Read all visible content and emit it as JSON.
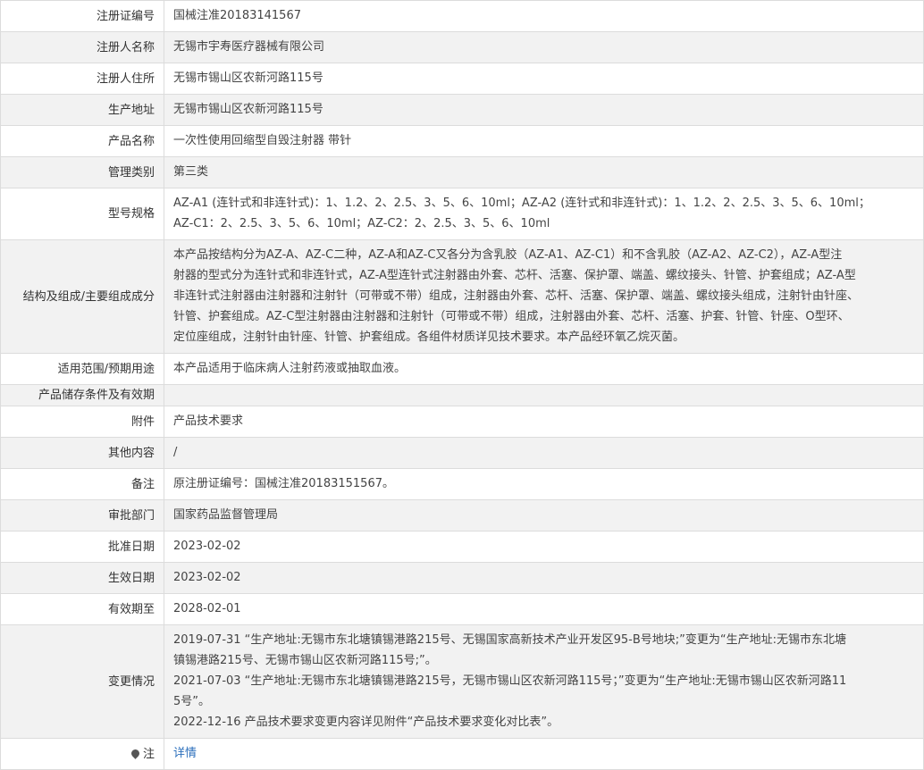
{
  "rows": {
    "reg_no": {
      "label": "注册证编号",
      "value": "国械注准20183141567"
    },
    "registrant": {
      "label": "注册人名称",
      "value": "无锡市宇寿医疗器械有限公司"
    },
    "registrant_address": {
      "label": "注册人住所",
      "value": "无锡市锡山区农新河路115号"
    },
    "production_address": {
      "label": "生产地址",
      "value": "无锡市锡山区农新河路115号"
    },
    "product_name": {
      "label": "产品名称",
      "value": "一次性使用回缩型自毁注射器 带针"
    },
    "category": {
      "label": "管理类别",
      "value": "第三类"
    },
    "model": {
      "label": "型号规格",
      "lines": [
        "AZ-A1 (连针式和非连针式)：1、1.2、2、2.5、3、5、6、10ml；AZ-A2 (连针式和非连针式)：1、1.2、2、2.5、3、5、6、10ml；",
        "AZ-C1：2、2.5、3、5、6、10ml；AZ-C2：2、2.5、3、5、6、10ml"
      ]
    },
    "structure": {
      "label": "结构及组成/主要组成成分",
      "lines": [
        "本产品按结构分为AZ-A、AZ-C二种，AZ-A和AZ-C又各分为含乳胶（AZ-A1、AZ-C1）和不含乳胶（AZ-A2、AZ-C2），AZ-A型注",
        "射器的型式分为连针式和非连针式，AZ-A型连针式注射器由外套、芯杆、活塞、保护罩、端盖、螺纹接头、针管、护套组成；AZ-A型",
        "非连针式注射器由注射器和注射针（可带或不带）组成，注射器由外套、芯杆、活塞、保护罩、端盖、螺纹接头组成，注射针由针座、",
        "针管、护套组成。AZ-C型注射器由注射器和注射针（可带或不带）组成，注射器由外套、芯杆、活塞、护套、针管、针座、O型环、",
        "定位座组成，注射针由针座、针管、护套组成。各组件材质详见技术要求。本产品经环氧乙烷灭菌。"
      ]
    },
    "usage": {
      "label": "适用范围/预期用途",
      "value": "本产品适用于临床病人注射药液或抽取血液。"
    },
    "storage": {
      "label": "产品储存条件及有效期",
      "value": ""
    },
    "attachment": {
      "label": "附件",
      "value": "产品技术要求"
    },
    "other": {
      "label": "其他内容",
      "value": "/"
    },
    "remark": {
      "label": "备注",
      "value": "原注册证编号：国械注准20183151567。"
    },
    "approval_dept": {
      "label": "审批部门",
      "value": "国家药品监督管理局"
    },
    "approval_date": {
      "label": "批准日期",
      "value": "2023-02-02"
    },
    "effective_date": {
      "label": "生效日期",
      "value": "2023-02-02"
    },
    "valid_until": {
      "label": "有效期至",
      "value": "2028-02-01"
    },
    "changes": {
      "label": "变更情况",
      "lines": [
        "2019-07-31 “生产地址:无锡市东北塘镇锡港路215号、无锡国家高新技术产业开发区95-B号地块;”变更为“生产地址:无锡市东北塘",
        "镇锡港路215号、无锡市锡山区农新河路115号;”。",
        "2021-07-03 “生产地址:无锡市东北塘镇锡港路215号，无锡市锡山区农新河路115号；”变更为“生产地址:无锡市锡山区农新河路11",
        "5号”。",
        "2022-12-16 产品技术要求变更内容详见附件“产品技术要求变化对比表”。"
      ]
    },
    "note": {
      "label": "注",
      "value": "详情"
    }
  }
}
